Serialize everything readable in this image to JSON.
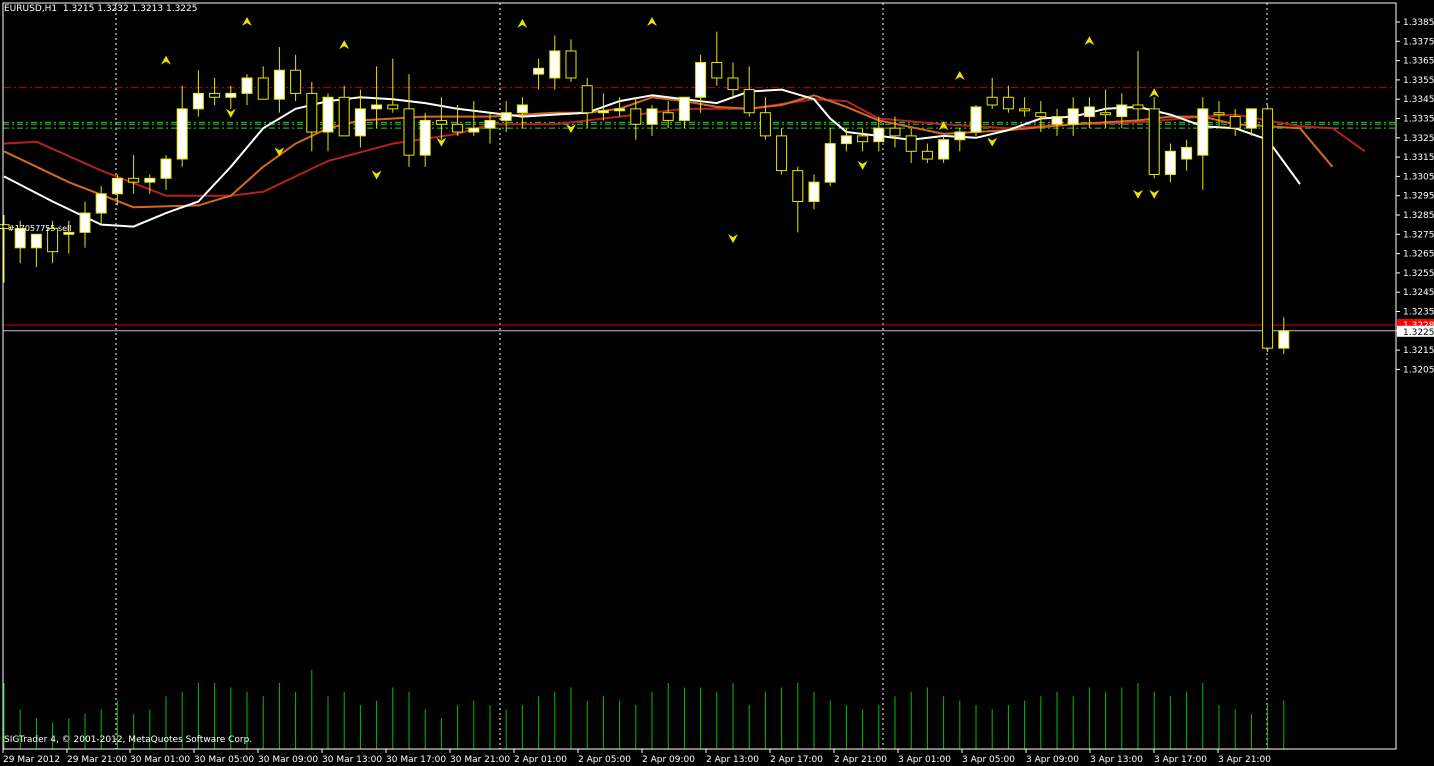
{
  "header": {
    "symbol": "EURUSD,H1",
    "open": "1.3215",
    "high": "1.3232",
    "low": "1.3213",
    "close": "1.3225"
  },
  "footer": {
    "copyright": "SIGTrader 4, © 2001-2012, MetaQuotes Software Corp."
  },
  "order": {
    "label": "#17057755 sell"
  },
  "colors": {
    "background": "#000000",
    "frame": "#ffffff",
    "bull_body": "#ffffff",
    "bear_body": "#000000",
    "candle_outline": "#e6e600",
    "fractal": "#e6e600",
    "ma_fast": "#ffffff",
    "ma_mid": "#d2691e",
    "ma_slow": "#b22222",
    "volume": "#00c000",
    "stop_line": "#cc0000",
    "bid_line": "#c0c0c0",
    "order_lines": "#33cc33",
    "price_marker_stop": "#ff0000"
  },
  "chart_data": {
    "type": "candlestick",
    "symbol": "EURUSD",
    "timeframe": "H1",
    "ylim": [
      1.32,
      1.339
    ],
    "y_ticks": [
      "1.3385",
      "1.3375",
      "1.3365",
      "1.3355",
      "1.3345",
      "1.3335",
      "1.3325",
      "1.3315",
      "1.3305",
      "1.3295",
      "1.3285",
      "1.3275",
      "1.3265",
      "1.3255",
      "1.3245",
      "1.3235",
      "1.3225",
      "1.3215",
      "1.3205"
    ],
    "x_labels": [
      "29 Mar 2012",
      "29 Mar 21:00",
      "30 Mar 01:00",
      "30 Mar 05:00",
      "30 Mar 09:00",
      "30 Mar 13:00",
      "30 Mar 17:00",
      "30 Mar 21:00",
      "2 Apr 01:00",
      "2 Apr 05:00",
      "2 Apr 09:00",
      "2 Apr 13:00",
      "2 Apr 17:00",
      "2 Apr 21:00",
      "3 Apr 01:00",
      "3 Apr 05:00",
      "3 Apr 09:00",
      "3 Apr 13:00",
      "3 Apr 17:00",
      "3 Apr 21:00"
    ],
    "candles": [
      [
        1.328,
        1.3285,
        1.325,
        1.3278
      ],
      [
        1.3268,
        1.3282,
        1.326,
        1.3278
      ],
      [
        1.3268,
        1.3275,
        1.3258,
        1.3275
      ],
      [
        1.3278,
        1.3282,
        1.326,
        1.3266
      ],
      [
        1.3275,
        1.3282,
        1.3265,
        1.3276
      ],
      [
        1.3276,
        1.3292,
        1.3268,
        1.3286
      ],
      [
        1.3286,
        1.33,
        1.328,
        1.3296
      ],
      [
        1.3296,
        1.3306,
        1.329,
        1.3304
      ],
      [
        1.3304,
        1.3316,
        1.3296,
        1.3302
      ],
      [
        1.3302,
        1.3306,
        1.3296,
        1.3304
      ],
      [
        1.3304,
        1.3316,
        1.3298,
        1.3314
      ],
      [
        1.3314,
        1.3352,
        1.331,
        1.334
      ],
      [
        1.334,
        1.336,
        1.3336,
        1.3348
      ],
      [
        1.3348,
        1.3356,
        1.3342,
        1.3346
      ],
      [
        1.3346,
        1.3352,
        1.334,
        1.3348
      ],
      [
        1.3348,
        1.3358,
        1.3342,
        1.3356
      ],
      [
        1.3356,
        1.3362,
        1.3346,
        1.3345
      ],
      [
        1.3345,
        1.3372,
        1.3338,
        1.336
      ],
      [
        1.336,
        1.3368,
        1.3344,
        1.3348
      ],
      [
        1.3348,
        1.3354,
        1.3318,
        1.3328
      ],
      [
        1.3328,
        1.3348,
        1.3318,
        1.3346
      ],
      [
        1.3346,
        1.3352,
        1.3328,
        1.3326
      ],
      [
        1.3326,
        1.335,
        1.332,
        1.334
      ],
      [
        1.334,
        1.3362,
        1.333,
        1.3342
      ],
      [
        1.3342,
        1.3366,
        1.3338,
        1.334
      ],
      [
        1.334,
        1.3358,
        1.331,
        1.3316
      ],
      [
        1.3316,
        1.3338,
        1.331,
        1.3334
      ],
      [
        1.3334,
        1.3346,
        1.3324,
        1.3332
      ],
      [
        1.3332,
        1.3342,
        1.3326,
        1.3328
      ],
      [
        1.3328,
        1.3344,
        1.3326,
        1.333
      ],
      [
        1.333,
        1.3338,
        1.3322,
        1.3334
      ],
      [
        1.3334,
        1.3344,
        1.3328,
        1.3338
      ],
      [
        1.3338,
        1.3346,
        1.333,
        1.3342
      ],
      [
        1.3358,
        1.3366,
        1.335,
        1.3361
      ],
      [
        1.3356,
        1.3378,
        1.335,
        1.337
      ],
      [
        1.337,
        1.3376,
        1.3354,
        1.3356
      ],
      [
        1.3352,
        1.3356,
        1.333,
        1.3338
      ],
      [
        1.3338,
        1.3348,
        1.3334,
        1.3339
      ],
      [
        1.3339,
        1.3346,
        1.3336,
        1.334
      ],
      [
        1.334,
        1.3346,
        1.3324,
        1.3332
      ],
      [
        1.3332,
        1.3342,
        1.3326,
        1.334
      ],
      [
        1.3338,
        1.3344,
        1.333,
        1.3334
      ],
      [
        1.3334,
        1.3346,
        1.333,
        1.3346
      ],
      [
        1.3346,
        1.3368,
        1.3338,
        1.3364
      ],
      [
        1.3364,
        1.338,
        1.3352,
        1.3356
      ],
      [
        1.3356,
        1.3364,
        1.3346,
        1.335
      ],
      [
        1.335,
        1.3362,
        1.3336,
        1.3338
      ],
      [
        1.3338,
        1.3346,
        1.3324,
        1.3326
      ],
      [
        1.3326,
        1.333,
        1.3306,
        1.3308
      ],
      [
        1.3308,
        1.331,
        1.3276,
        1.3292
      ],
      [
        1.3292,
        1.3306,
        1.3288,
        1.3302
      ],
      [
        1.3302,
        1.333,
        1.33,
        1.3322
      ],
      [
        1.3322,
        1.333,
        1.3318,
        1.3326
      ],
      [
        1.3326,
        1.333,
        1.3318,
        1.3323
      ],
      [
        1.3323,
        1.3336,
        1.3318,
        1.333
      ],
      [
        1.333,
        1.3336,
        1.332,
        1.3326
      ],
      [
        1.3326,
        1.333,
        1.3312,
        1.3318
      ],
      [
        1.3318,
        1.3322,
        1.3312,
        1.3314
      ],
      [
        1.3314,
        1.3326,
        1.3312,
        1.3324
      ],
      [
        1.3324,
        1.333,
        1.3318,
        1.3328
      ],
      [
        1.3328,
        1.3342,
        1.3326,
        1.3341
      ],
      [
        1.3346,
        1.3356,
        1.334,
        1.3342
      ],
      [
        1.3346,
        1.3352,
        1.3338,
        1.334
      ],
      [
        1.334,
        1.3346,
        1.3336,
        1.3339
      ],
      [
        1.3338,
        1.3344,
        1.3328,
        1.3336
      ],
      [
        1.3332,
        1.334,
        1.3326,
        1.3336
      ],
      [
        1.3332,
        1.3346,
        1.3326,
        1.334
      ],
      [
        1.3336,
        1.3346,
        1.333,
        1.3341
      ],
      [
        1.3338,
        1.335,
        1.333,
        1.3337
      ],
      [
        1.3336,
        1.3348,
        1.333,
        1.3342
      ],
      [
        1.3342,
        1.337,
        1.3334,
        1.334
      ],
      [
        1.334,
        1.3346,
        1.3304,
        1.3306
      ],
      [
        1.3306,
        1.3322,
        1.3302,
        1.3318
      ],
      [
        1.3314,
        1.3324,
        1.3308,
        1.332
      ],
      [
        1.3316,
        1.3346,
        1.3298,
        1.334
      ],
      [
        1.3338,
        1.3344,
        1.333,
        1.3337
      ],
      [
        1.3336,
        1.334,
        1.3326,
        1.333
      ],
      [
        1.333,
        1.3338,
        1.3326,
        1.334
      ],
      [
        1.334,
        1.3342,
        1.3214,
        1.3216
      ],
      [
        1.3216,
        1.3232,
        1.3213,
        1.3225
      ]
    ],
    "ma_fast": [
      [
        0,
        1.3305
      ],
      [
        3,
        1.3292
      ],
      [
        6,
        1.328
      ],
      [
        8,
        1.3279
      ],
      [
        10,
        1.3286
      ],
      [
        12,
        1.3292
      ],
      [
        14,
        1.331
      ],
      [
        16,
        1.333
      ],
      [
        18,
        1.334
      ],
      [
        20,
        1.3344
      ],
      [
        22,
        1.3346
      ],
      [
        24,
        1.3345
      ],
      [
        26,
        1.3343
      ],
      [
        28,
        1.334
      ],
      [
        30,
        1.3338
      ],
      [
        32,
        1.3336
      ],
      [
        34,
        1.3337
      ],
      [
        36,
        1.3338
      ],
      [
        38,
        1.3344
      ],
      [
        40,
        1.3347
      ],
      [
        42,
        1.3345
      ],
      [
        44,
        1.3343
      ],
      [
        46,
        1.3349
      ],
      [
        48,
        1.335
      ],
      [
        50,
        1.3345
      ],
      [
        51,
        1.3335
      ],
      [
        52,
        1.3328
      ],
      [
        54,
        1.3326
      ],
      [
        56,
        1.3324
      ],
      [
        58,
        1.3326
      ],
      [
        60,
        1.3325
      ],
      [
        62,
        1.3329
      ],
      [
        64,
        1.3335
      ],
      [
        66,
        1.3336
      ],
      [
        68,
        1.334
      ],
      [
        70,
        1.3341
      ],
      [
        72,
        1.3337
      ],
      [
        74,
        1.3331
      ],
      [
        76,
        1.333
      ],
      [
        78,
        1.3324
      ],
      [
        80,
        1.3301
      ]
    ],
    "ma_mid": [
      [
        0,
        1.3318
      ],
      [
        4,
        1.3302
      ],
      [
        8,
        1.3289
      ],
      [
        12,
        1.329
      ],
      [
        14,
        1.3295
      ],
      [
        16,
        1.331
      ],
      [
        18,
        1.3322
      ],
      [
        20,
        1.333
      ],
      [
        22,
        1.3334
      ],
      [
        26,
        1.3336
      ],
      [
        30,
        1.3336
      ],
      [
        34,
        1.3338
      ],
      [
        36,
        1.3338
      ],
      [
        38,
        1.334
      ],
      [
        40,
        1.3346
      ],
      [
        42,
        1.3344
      ],
      [
        44,
        1.3341
      ],
      [
        46,
        1.334
      ],
      [
        48,
        1.3342
      ],
      [
        50,
        1.3347
      ],
      [
        52,
        1.3341
      ],
      [
        54,
        1.3334
      ],
      [
        58,
        1.3327
      ],
      [
        62,
        1.3329
      ],
      [
        66,
        1.3332
      ],
      [
        70,
        1.3334
      ],
      [
        72,
        1.3336
      ],
      [
        74,
        1.3336
      ],
      [
        76,
        1.3332
      ],
      [
        78,
        1.3331
      ],
      [
        80,
        1.333
      ],
      [
        82,
        1.331
      ]
    ],
    "ma_slow": [
      [
        0,
        1.3322
      ],
      [
        2,
        1.3323
      ],
      [
        6,
        1.3308
      ],
      [
        10,
        1.3295
      ],
      [
        14,
        1.3295
      ],
      [
        16,
        1.3297
      ],
      [
        20,
        1.3313
      ],
      [
        24,
        1.3322
      ],
      [
        28,
        1.3327
      ],
      [
        30,
        1.3332
      ],
      [
        34,
        1.3332
      ],
      [
        38,
        1.3336
      ],
      [
        42,
        1.334
      ],
      [
        46,
        1.334
      ],
      [
        50,
        1.3345
      ],
      [
        52,
        1.3344
      ],
      [
        54,
        1.3335
      ],
      [
        58,
        1.3332
      ],
      [
        62,
        1.333
      ],
      [
        66,
        1.3332
      ],
      [
        70,
        1.3333
      ],
      [
        74,
        1.3336
      ],
      [
        76,
        1.3337
      ],
      [
        78,
        1.3334
      ],
      [
        80,
        1.3331
      ],
      [
        82,
        1.333
      ],
      [
        84,
        1.3318
      ]
    ],
    "fractals_up": [
      [
        10,
        1.3365
      ],
      [
        15,
        1.3385
      ],
      [
        21,
        1.3373
      ],
      [
        32,
        1.3384
      ],
      [
        40,
        1.3385
      ],
      [
        58,
        1.3331
      ],
      [
        59,
        1.3357
      ],
      [
        67,
        1.3375
      ],
      [
        71,
        1.3348
      ]
    ],
    "fractals_down": [
      [
        14,
        1.3338
      ],
      [
        17,
        1.3318
      ],
      [
        23,
        1.3306
      ],
      [
        27,
        1.3323
      ],
      [
        35,
        1.333
      ],
      [
        45,
        1.3273
      ],
      [
        53,
        1.3311
      ],
      [
        61,
        1.3323
      ],
      [
        70,
        1.3296
      ],
      [
        71,
        1.3296
      ]
    ],
    "volume": [
      30,
      18,
      14,
      12,
      14,
      16,
      18,
      22,
      16,
      18,
      24,
      26,
      30,
      30,
      28,
      26,
      24,
      30,
      26,
      36,
      24,
      26,
      20,
      22,
      28,
      26,
      18,
      14,
      20,
      22,
      20,
      18,
      20,
      24,
      26,
      28,
      22,
      24,
      22,
      20,
      26,
      30,
      28,
      28,
      26,
      30,
      20,
      26,
      28,
      30,
      26,
      22,
      20,
      18,
      20,
      24,
      26,
      28,
      24,
      22,
      20,
      18,
      20,
      22,
      24,
      26,
      24,
      28,
      26,
      28,
      30,
      26,
      24,
      26,
      30,
      20,
      18,
      16,
      20,
      22
    ],
    "horizontal_lines": {
      "upper_dashed": 1.3351,
      "order_levels": [
        1.3333,
        1.3332,
        1.333
      ],
      "stop_level": 1.3228,
      "bid_level": 1.3225
    },
    "bid_price": "1.3225",
    "stop_price": "1.3228",
    "grid": "vertical dotted separators"
  }
}
